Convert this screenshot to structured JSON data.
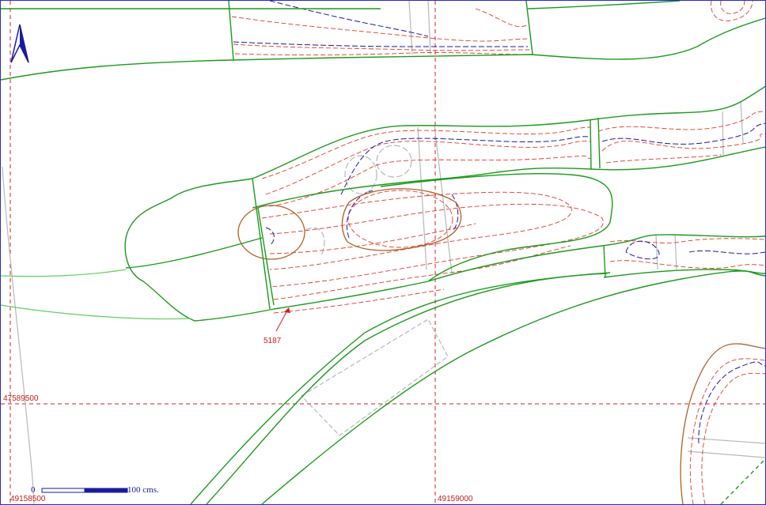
{
  "map": {
    "grid_labels": {
      "northing": "47589500",
      "easting_left": "49158500",
      "easting_center": "49159000"
    },
    "annotation": {
      "parcel_id": "5187"
    },
    "scale_bar": {
      "start_label": "0",
      "end_label": "100 cms."
    },
    "north_arrow": "north-arrow-icon",
    "colors": {
      "frame": "#2a2ad0",
      "grid": "#d02020",
      "parcel_outline": "#1c9a1c",
      "contour_red": "#e03a2a",
      "contour_blue": "#1a1aa0",
      "road_gray": "#b0b0b0",
      "depression_brown": "#b0602a",
      "light_green": "#5ed05e"
    }
  }
}
